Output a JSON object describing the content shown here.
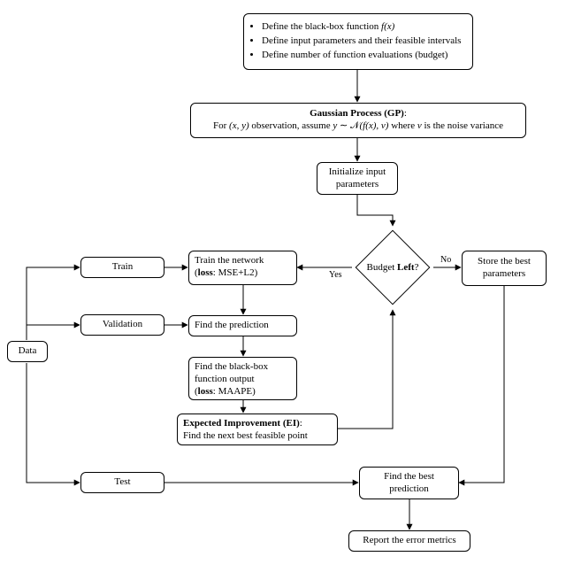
{
  "chart_data": {
    "type": "flowchart",
    "nodes": [
      {
        "id": "define",
        "kind": "process",
        "lines": [
          "Define the black-box function f(x)",
          "Define input parameters and their feasible intervals",
          "Define number of function evaluations (budget)"
        ]
      },
      {
        "id": "gp",
        "kind": "process",
        "title": "Gaussian Process (GP):",
        "body": "For (x, y) observation, assume y ∼ 𝒩(f(x), ν) where ν is the noise variance"
      },
      {
        "id": "init",
        "kind": "process",
        "text": "Initialize input parameters"
      },
      {
        "id": "budget",
        "kind": "decision",
        "text": "Budget Left?"
      },
      {
        "id": "store",
        "kind": "process",
        "text": "Store the best parameters"
      },
      {
        "id": "data",
        "kind": "process",
        "text": "Data"
      },
      {
        "id": "train",
        "kind": "process",
        "text": "Train"
      },
      {
        "id": "validation",
        "kind": "process",
        "text": "Validation"
      },
      {
        "id": "test",
        "kind": "process",
        "text": "Test"
      },
      {
        "id": "train_net",
        "kind": "process",
        "text": "Train the network (loss: MSE+L2)"
      },
      {
        "id": "find_pred",
        "kind": "process",
        "text": "Find the prediction"
      },
      {
        "id": "bbox_out",
        "kind": "process",
        "text": "Find the black-box function output (loss: MAAPE)"
      },
      {
        "id": "ei",
        "kind": "process",
        "title": "Expected Improvement (EI):",
        "body": "Find the next best feasible point"
      },
      {
        "id": "best_pred",
        "kind": "process",
        "text": "Find the best prediction"
      },
      {
        "id": "report",
        "kind": "process",
        "text": "Report the error metrics"
      }
    ],
    "edges": [
      {
        "from": "define",
        "to": "gp"
      },
      {
        "from": "gp",
        "to": "init"
      },
      {
        "from": "init",
        "to": "budget"
      },
      {
        "from": "budget",
        "to": "train_net",
        "label": "Yes"
      },
      {
        "from": "budget",
        "to": "store",
        "label": "No"
      },
      {
        "from": "train_net",
        "to": "find_pred"
      },
      {
        "from": "find_pred",
        "to": "bbox_out"
      },
      {
        "from": "bbox_out",
        "to": "ei"
      },
      {
        "from": "ei",
        "to": "budget",
        "note": "loop back"
      },
      {
        "from": "data",
        "to": "train"
      },
      {
        "from": "data",
        "to": "validation"
      },
      {
        "from": "data",
        "to": "test"
      },
      {
        "from": "train",
        "to": "train_net"
      },
      {
        "from": "validation",
        "to": "find_pred"
      },
      {
        "from": "store",
        "to": "best_pred"
      },
      {
        "from": "test",
        "to": "best_pred"
      },
      {
        "from": "best_pred",
        "to": "report"
      }
    ]
  },
  "nodes": {
    "define": {
      "line1": "Define the black-box function ",
      "fx": "f(x)",
      "line2": "Define input parameters and their feasible intervals",
      "line3": "Define number of function evaluations (budget)"
    },
    "gp": {
      "title": "Gaussian Process (GP)",
      "colon": ":",
      "body_pre": "For ",
      "xy": "(x, y)",
      "body_mid": " observation, assume ",
      "y": "y",
      "tilde": " ∼ ",
      "N": "𝒩",
      "args": "(f(x), ν)",
      "body_post": " where ",
      "nu": "ν",
      "body_end": " is the noise variance"
    },
    "init": {
      "text": "Initialize input\nparameters"
    },
    "budget": {
      "text_pre": "Budget ",
      "bold": "Left",
      "q": "?"
    },
    "store": {
      "text": "Store the best\nparameters"
    },
    "data": {
      "text": "Data"
    },
    "train": {
      "text": "Train"
    },
    "validation": {
      "text": "Validation"
    },
    "test": {
      "text": "Test"
    },
    "train_net": {
      "line1": "Train the network",
      "line2_pre": "(",
      "loss_bold": "loss",
      "line2_mid": ":  MSE+L2)",
      "close": ""
    },
    "find_pred": {
      "text": "Find the prediction"
    },
    "bbox_out": {
      "line1": "Find the black-box",
      "line2": "function output",
      "line3_pre": "(",
      "loss_bold": "loss",
      "line3_post": ":  MAAPE)"
    },
    "ei": {
      "title": "Expected Improvement (EI)",
      "colon": ":",
      "body": "Find the next best feasible point"
    },
    "best_pred": {
      "text": "Find the best\nprediction"
    },
    "report": {
      "text": "Report the error metrics"
    }
  },
  "labels": {
    "yes": "Yes",
    "no": "No"
  }
}
